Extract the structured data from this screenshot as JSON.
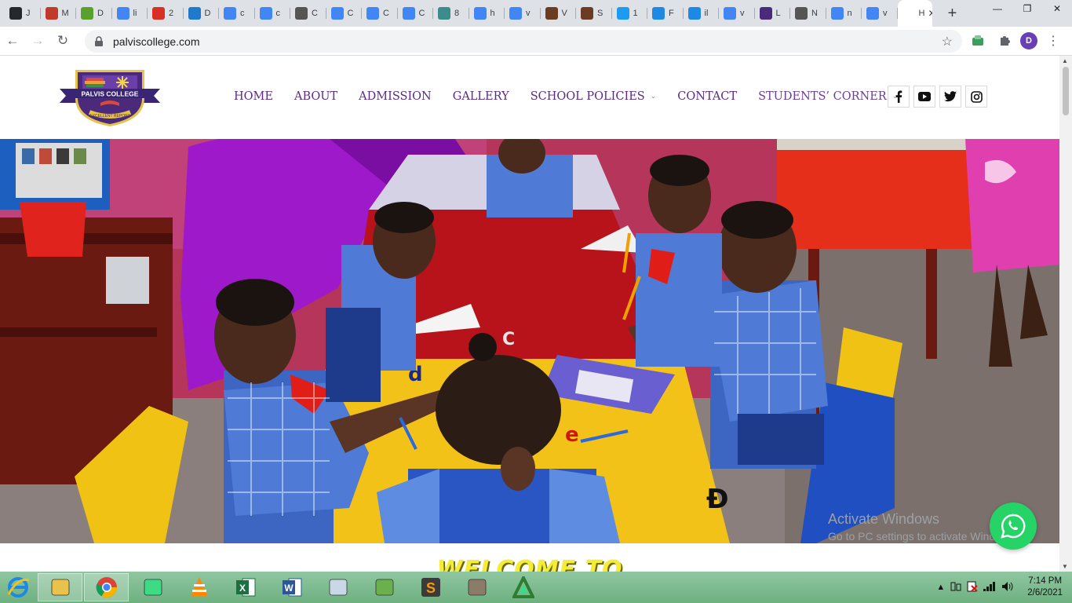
{
  "browser": {
    "tabs": [
      {
        "label": "J",
        "icon": "github-icon",
        "color": "#24292e"
      },
      {
        "label": "M",
        "icon": "hsu-icon",
        "color": "#c0392b"
      },
      {
        "label": "D",
        "icon": "android-download-icon",
        "color": "#5aa02c"
      },
      {
        "label": "li",
        "icon": "google-icon",
        "color": "#4285f4"
      },
      {
        "label": "2",
        "icon": "gmail-icon",
        "color": "#d93025"
      },
      {
        "label": "D",
        "icon": "vscode-icon",
        "color": "#1f7acc"
      },
      {
        "label": "c",
        "icon": "google-icon",
        "color": "#4285f4"
      },
      {
        "label": "c",
        "icon": "google-icon",
        "color": "#4285f4"
      },
      {
        "label": "C",
        "icon": "link-icon",
        "color": "#555555"
      },
      {
        "label": "C",
        "icon": "google-icon",
        "color": "#4285f4"
      },
      {
        "label": "C",
        "icon": "google-icon",
        "color": "#4285f4"
      },
      {
        "label": "C",
        "icon": "google-icon",
        "color": "#4285f4"
      },
      {
        "label": "8",
        "icon": "d-icon",
        "color": "#3c8c8c"
      },
      {
        "label": "h",
        "icon": "google-icon",
        "color": "#4285f4"
      },
      {
        "label": "v",
        "icon": "google-icon",
        "color": "#4285f4"
      },
      {
        "label": "V",
        "icon": "photo-icon",
        "color": "#6b3b22"
      },
      {
        "label": "S",
        "icon": "photo-icon",
        "color": "#6b3b22"
      },
      {
        "label": "1",
        "icon": "t-icon",
        "color": "#1d9bf0"
      },
      {
        "label": "F",
        "icon": "arrow-icon",
        "color": "#1e88e5"
      },
      {
        "label": "il",
        "icon": "arrow-icon",
        "color": "#1e88e5"
      },
      {
        "label": "v",
        "icon": "google-icon",
        "color": "#4285f4"
      },
      {
        "label": "L",
        "icon": "palvis-icon",
        "color": "#4b2a7b"
      },
      {
        "label": "N",
        "icon": "globe-icon",
        "color": "#555555"
      },
      {
        "label": "n",
        "icon": "google-icon",
        "color": "#4285f4"
      },
      {
        "label": "v",
        "icon": "google-icon",
        "color": "#4285f4"
      },
      {
        "label": "H",
        "icon": "page-icon",
        "color": "#ffffff",
        "active": true
      }
    ],
    "url": "palviscollege.com",
    "profile_initial": "D"
  },
  "site": {
    "logo_text": "PALVIS COLLEGE",
    "logo_motto": "EXCELLENT REPORT",
    "nav": [
      {
        "label": "HOME",
        "dropdown": false
      },
      {
        "label": "ABOUT",
        "dropdown": false
      },
      {
        "label": "ADMISSION",
        "dropdown": false
      },
      {
        "label": "GALLERY",
        "dropdown": false
      },
      {
        "label": "SCHOOL POLICIES",
        "dropdown": true
      },
      {
        "label": "CONTACT",
        "dropdown": false
      },
      {
        "label": "STUDENTS’ CORNER",
        "dropdown": true
      }
    ],
    "social": [
      "facebook-icon",
      "youtube-icon",
      "twitter-icon",
      "instagram-icon"
    ],
    "welcome_heading": "WELCOME TO"
  },
  "os": {
    "activate_title": "Activate Windows",
    "activate_sub": "Go to PC settings to activate Windows.",
    "time": "7:14 PM",
    "date": "2/6/2021",
    "taskbar_apps": [
      "internet-explorer-icon",
      "file-explorer-icon",
      "chrome-icon",
      "android-studio-icon",
      "vlc-icon",
      "excel-icon",
      "word-icon",
      "calculator-icon",
      "paint-icon",
      "sublime-text-icon",
      "gimp-icon",
      "android-icon"
    ]
  },
  "colors": {
    "brand_purple": "#5b2a86",
    "whatsapp_green": "#25d366",
    "welcome_yellow": "#f5ec3a"
  }
}
